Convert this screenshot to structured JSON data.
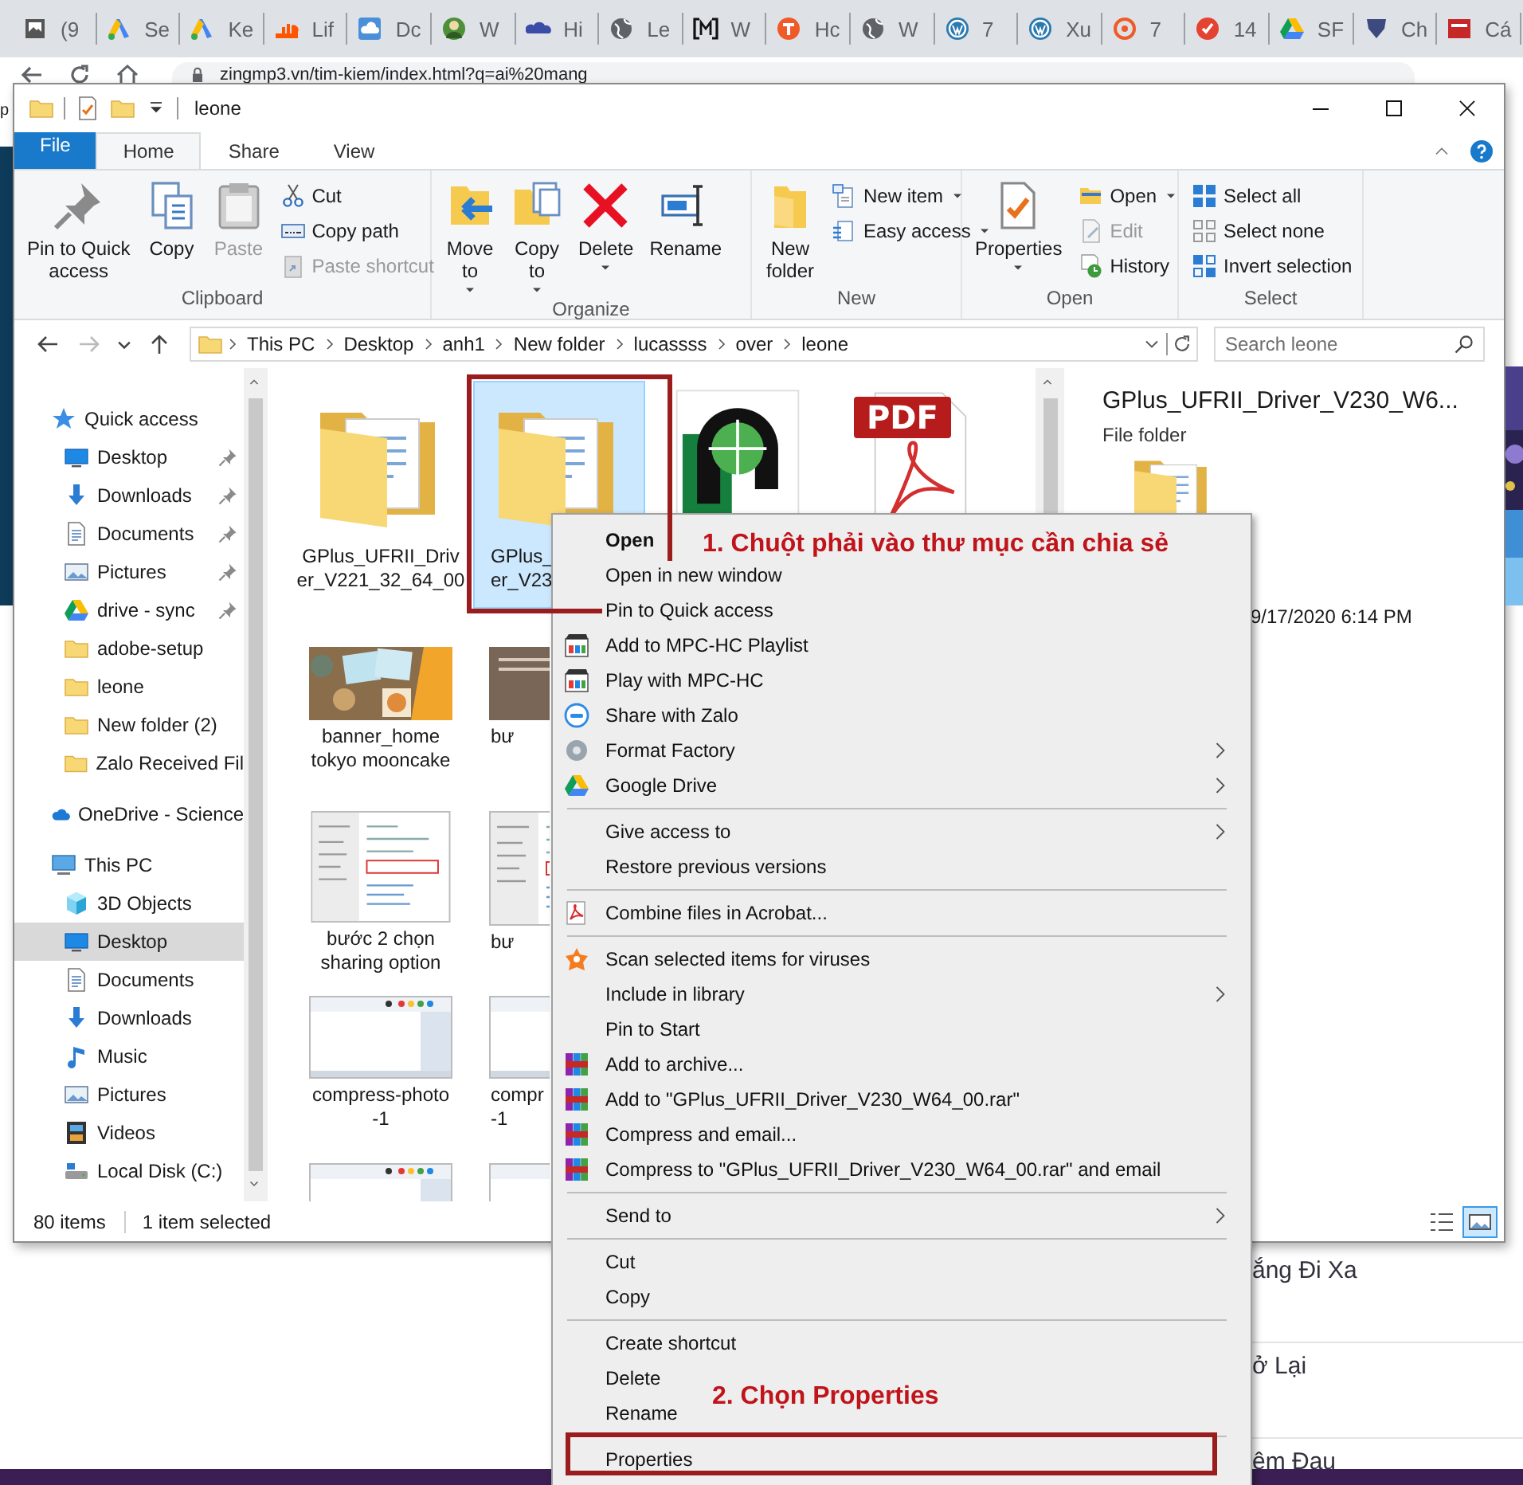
{
  "browser": {
    "tabs": [
      {
        "label": "(9"
      },
      {
        "label": "Se"
      },
      {
        "label": "Ke"
      },
      {
        "label": "Lif"
      },
      {
        "label": "Dc"
      },
      {
        "label": "W"
      },
      {
        "label": "Hi"
      },
      {
        "label": "Le"
      },
      {
        "label": "W"
      },
      {
        "label": "Hc"
      },
      {
        "label": "W"
      },
      {
        "label": "7"
      },
      {
        "label": "Xu"
      },
      {
        "label": "7"
      },
      {
        "label": "14"
      },
      {
        "label": "SF"
      },
      {
        "label": "Ch"
      },
      {
        "label": "Cá"
      }
    ],
    "address": "zingmp3.vn/tim-kiem/index.html?q=ai%20mang"
  },
  "background_page": {
    "edge_text": "p",
    "items": [
      "ắng Đi Xa",
      "ở Lại",
      "êm Đau"
    ]
  },
  "window": {
    "title": "leone"
  },
  "ribbon": {
    "tabs": [
      {
        "kind": "file",
        "label": "File",
        "selected": false
      },
      {
        "kind": "tab",
        "label": "Home",
        "selected": true
      },
      {
        "kind": "tab",
        "label": "Share",
        "selected": false
      },
      {
        "kind": "tab",
        "label": "View",
        "selected": false
      }
    ],
    "groups": [
      {
        "name": "Clipboard",
        "items": [
          {
            "kind": "large",
            "label": "Pin to Quick\naccess",
            "disabled": false,
            "dropdown": false
          },
          {
            "kind": "large",
            "label": "Copy",
            "disabled": false,
            "dropdown": false
          },
          {
            "kind": "large",
            "label": "Paste",
            "disabled": true,
            "dropdown": false
          },
          {
            "kind": "small",
            "label": "Cut",
            "disabled": false,
            "dropdown": false
          },
          {
            "kind": "small",
            "label": "Copy path",
            "disabled": false,
            "dropdown": false
          },
          {
            "kind": "small",
            "label": "Paste shortcut",
            "disabled": true,
            "dropdown": false
          }
        ]
      },
      {
        "name": "Organize",
        "items": [
          {
            "kind": "large",
            "label": "Move\nto",
            "disabled": false,
            "dropdown": true
          },
          {
            "kind": "large",
            "label": "Copy\nto",
            "disabled": false,
            "dropdown": true
          },
          {
            "kind": "large",
            "label": "Delete",
            "disabled": false,
            "dropdown": true
          },
          {
            "kind": "large",
            "label": "Rename",
            "disabled": false,
            "dropdown": false
          }
        ]
      },
      {
        "name": "New",
        "items": [
          {
            "kind": "large",
            "label": "New\nfolder",
            "disabled": false,
            "dropdown": false
          },
          {
            "kind": "small",
            "label": "New item",
            "disabled": false,
            "dropdown": true
          },
          {
            "kind": "small",
            "label": "Easy access",
            "disabled": false,
            "dropdown": true
          }
        ]
      },
      {
        "name": "Open",
        "items": [
          {
            "kind": "large",
            "label": "Properties",
            "disabled": false,
            "dropdown": true
          },
          {
            "kind": "small",
            "label": "Open",
            "disabled": false,
            "dropdown": true
          },
          {
            "kind": "small",
            "label": "Edit",
            "disabled": true,
            "dropdown": false
          },
          {
            "kind": "small",
            "label": "History",
            "disabled": false,
            "dropdown": false
          }
        ]
      },
      {
        "name": "Select",
        "items": [
          {
            "kind": "small",
            "label": "Select all",
            "disabled": false,
            "dropdown": false
          },
          {
            "kind": "small",
            "label": "Select none",
            "disabled": false,
            "dropdown": false
          },
          {
            "kind": "small",
            "label": "Invert selection",
            "disabled": false,
            "dropdown": false
          }
        ]
      }
    ]
  },
  "address_bar": {
    "navigation": [
      {
        "kind": "back",
        "disabled": false
      },
      {
        "kind": "forward",
        "disabled": true
      },
      {
        "kind": "recent",
        "disabled": false
      },
      {
        "kind": "up",
        "disabled": false
      }
    ],
    "breadcrumb": [
      "This PC",
      "Desktop",
      "anh1",
      "New folder",
      "lucassss",
      "over",
      "leone"
    ],
    "search": {
      "placeholder": "Search leone"
    }
  },
  "navigation_pane": [
    {
      "label": "Quick access",
      "selected": false,
      "children": [
        {
          "label": "Desktop",
          "pinned": true,
          "selected": false
        },
        {
          "label": "Downloads",
          "pinned": true,
          "selected": false
        },
        {
          "label": "Documents",
          "pinned": true,
          "selected": false
        },
        {
          "label": "Pictures",
          "pinned": true,
          "selected": false
        },
        {
          "label": "drive - sync",
          "pinned": true,
          "selected": false
        },
        {
          "label": "adobe-setup",
          "pinned": false,
          "selected": false
        },
        {
          "label": "leone",
          "pinned": false,
          "selected": false
        },
        {
          "label": "New folder (2)",
          "pinned": false,
          "selected": false
        },
        {
          "label": "Zalo Received Fil",
          "pinned": false,
          "selected": false
        }
      ]
    },
    {
      "label": "OneDrive - Science",
      "selected": false
    },
    {
      "label": "This PC",
      "selected": false,
      "children": [
        {
          "label": "3D Objects",
          "selected": false
        },
        {
          "label": "Desktop",
          "selected": true
        },
        {
          "label": "Documents",
          "selected": false
        },
        {
          "label": "Downloads",
          "selected": false
        },
        {
          "label": "Music",
          "selected": false
        },
        {
          "label": "Pictures",
          "selected": false
        },
        {
          "label": "Videos",
          "selected": false
        },
        {
          "label": "Local Disk (C:)",
          "selected": false
        }
      ]
    }
  ],
  "files": [
    {
      "kind": "folder",
      "label": "GPlus_UFRII_Driv\ner_V221_32_64_00",
      "selected": false
    },
    {
      "kind": "folder",
      "label": "GPlus_\ner_V23",
      "selected": true
    },
    {
      "kind": "logo",
      "selected": false
    },
    {
      "kind": "pdf",
      "badge": "PDF",
      "selected": false
    },
    {
      "label": "banner_home\ntokyo mooncake",
      "selected": false
    },
    {
      "kind": "slide",
      "label": "bư",
      "selected": false
    },
    {
      "kind": "screenshot",
      "label": "bước 2 chọn\nsharing option",
      "selected": false
    },
    {
      "kind": "screenshot",
      "label": "bư",
      "selected": false
    },
    {
      "kind": "paint",
      "label": "compress-photo\n-1",
      "selected": false
    },
    {
      "kind": "paint",
      "label": "compr\n-1",
      "selected": false
    },
    {
      "kind": "paint",
      "selected": false
    },
    {
      "kind": "paint",
      "selected": false
    }
  ],
  "details_pane": {
    "title": "GPlus_UFRII_Driver_V230_W6...",
    "type": "File folder",
    "date": "9/17/2020 6:14 PM"
  },
  "status_bar": {
    "count": "80 items",
    "selection": "1 item selected",
    "views": [
      {
        "kind": "details",
        "selected": false
      },
      {
        "kind": "large-icons",
        "selected": true
      }
    ]
  },
  "context_menu": [
    {
      "kind": "item",
      "label": "Open",
      "default": true,
      "submenu": false
    },
    {
      "kind": "item",
      "label": "Open in new window",
      "default": false,
      "submenu": false
    },
    {
      "kind": "item",
      "label": "Pin to Quick access",
      "default": false,
      "submenu": false
    },
    {
      "kind": "item",
      "label": "Add to MPC-HC Playlist",
      "default": false,
      "submenu": false
    },
    {
      "kind": "item",
      "label": "Play with MPC-HC",
      "default": false,
      "submenu": false
    },
    {
      "kind": "item",
      "label": "Share with Zalo",
      "default": false,
      "submenu": false
    },
    {
      "kind": "item",
      "label": "Format Factory",
      "default": false,
      "submenu": true
    },
    {
      "kind": "item",
      "label": "Google Drive",
      "default": false,
      "submenu": true
    },
    {
      "kind": "separator"
    },
    {
      "kind": "item",
      "label": "Give access to",
      "default": false,
      "submenu": true
    },
    {
      "kind": "item",
      "label": "Restore previous versions",
      "default": false,
      "submenu": false
    },
    {
      "kind": "separator"
    },
    {
      "kind": "item",
      "label": "Combine files in Acrobat...",
      "default": false,
      "submenu": false
    },
    {
      "kind": "separator"
    },
    {
      "kind": "item",
      "label": "Scan selected items for viruses",
      "default": false,
      "submenu": false
    },
    {
      "kind": "item",
      "label": "Include in library",
      "default": false,
      "submenu": true
    },
    {
      "kind": "item",
      "label": "Pin to Start",
      "default": false,
      "submenu": false
    },
    {
      "kind": "item",
      "label": "Add to archive...",
      "default": false,
      "submenu": false
    },
    {
      "kind": "item",
      "label": "Add to \"GPlus_UFRII_Driver_V230_W64_00.rar\"",
      "default": false,
      "submenu": false
    },
    {
      "kind": "item",
      "label": "Compress and email...",
      "default": false,
      "submenu": false
    },
    {
      "kind": "item",
      "label": "Compress to \"GPlus_UFRII_Driver_V230_W64_00.rar\" and email",
      "default": false,
      "submenu": false
    },
    {
      "kind": "separator"
    },
    {
      "kind": "item",
      "label": "Send to",
      "default": false,
      "submenu": true
    },
    {
      "kind": "separator"
    },
    {
      "kind": "item",
      "label": "Cut",
      "default": false,
      "submenu": false
    },
    {
      "kind": "item",
      "label": "Copy",
      "default": false,
      "submenu": false
    },
    {
      "kind": "separator"
    },
    {
      "kind": "item",
      "label": "Create shortcut",
      "default": false,
      "submenu": false
    },
    {
      "kind": "item",
      "label": "Delete",
      "default": false,
      "submenu": false
    },
    {
      "kind": "item",
      "label": "Rename",
      "default": false,
      "submenu": false
    },
    {
      "kind": "separator"
    },
    {
      "kind": "item",
      "label": "Properties",
      "default": false,
      "submenu": false
    }
  ],
  "annotations": [
    {
      "text": "1. Chuột phải vào thư mục cần chia sẻ"
    },
    {
      "text": "2. Chọn Properties"
    }
  ]
}
